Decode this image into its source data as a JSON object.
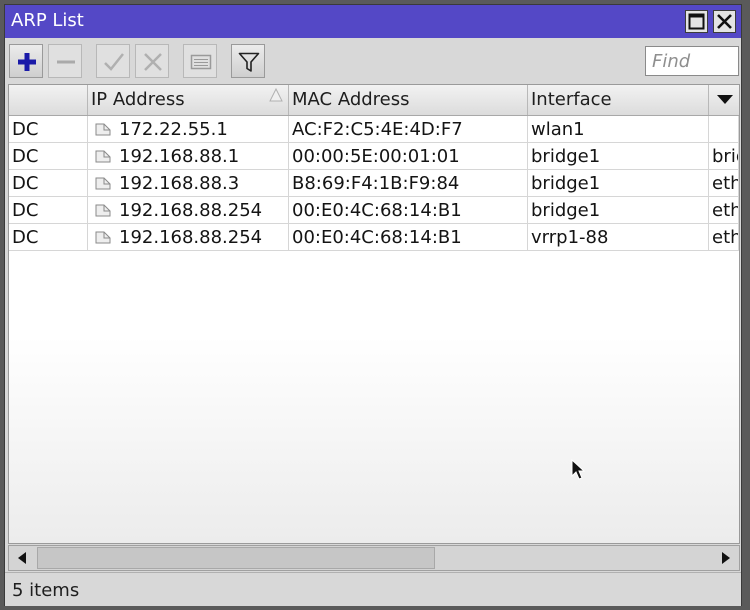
{
  "window": {
    "title": "ARP List"
  },
  "toolbar": {
    "find_placeholder": "Find"
  },
  "table": {
    "columns": [
      "",
      "IP Address",
      "MAC Address",
      "Interface",
      ""
    ],
    "rows": [
      {
        "flags": "DC",
        "ip": "172.22.55.1",
        "mac": "AC:F2:C5:4E:4D:F7",
        "interface": "wlan1",
        "extra": ""
      },
      {
        "flags": "DC",
        "ip": "192.168.88.1",
        "mac": "00:00:5E:00:01:01",
        "interface": "bridge1",
        "extra": "brid"
      },
      {
        "flags": "DC",
        "ip": "192.168.88.3",
        "mac": "B8:69:F4:1B:F9:84",
        "interface": "bridge1",
        "extra": "ethe"
      },
      {
        "flags": "DC",
        "ip": "192.168.88.254",
        "mac": "00:E0:4C:68:14:B1",
        "interface": "bridge1",
        "extra": "ethe"
      },
      {
        "flags": "DC",
        "ip": "192.168.88.254",
        "mac": "00:E0:4C:68:14:B1",
        "interface": "vrrp1-88",
        "extra": "ethe"
      }
    ]
  },
  "status": {
    "count_text": "5 items"
  },
  "colors": {
    "titlebar": "#5448c6",
    "add_icon": "#1a1aa8"
  }
}
